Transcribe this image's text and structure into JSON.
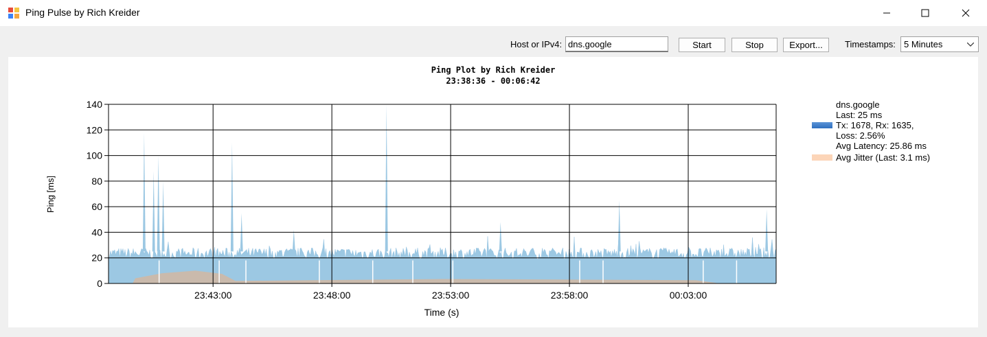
{
  "window": {
    "title": "Ping Pulse by Rich Kreider"
  },
  "toolbar": {
    "host_label": "Host or IPv4:",
    "host_value": "dns.google",
    "start_label": "Start",
    "stop_label": "Stop",
    "export_label": "Export...",
    "timestamps_label": "Timestamps:",
    "timestamps_value": "5 Minutes"
  },
  "colors": {
    "ping_fill": "#9cc8e3",
    "jitter_fill": "#d9b59a",
    "legend_ping": "#2f6fbf",
    "legend_jitter": "#fcd5b8"
  },
  "chart_data": {
    "type": "area",
    "title": "Ping Plot by Rich Kreider",
    "subtitle": "23:38:36 - 00:06:42",
    "xlabel": "Time (s)",
    "ylabel": "Ping [ms]",
    "ylim": [
      0,
      140
    ],
    "yticks": [
      "0",
      "20",
      "40",
      "60",
      "80",
      "100",
      "120",
      "140"
    ],
    "xticks": [
      "23:43:00",
      "23:48:00",
      "23:53:00",
      "23:58:00",
      "00:03:00"
    ],
    "xrange": [
      "23:38:36",
      "00:06:42"
    ],
    "grid": true,
    "legend_position": "right",
    "legend": {
      "host": "dns.google",
      "last": "Last: 25 ms",
      "txrx": "Tx: 1678, Rx: 1635,",
      "loss": "Loss: 2.56%",
      "avg_latency": "Avg Latency: 25.86 ms",
      "jitter": "Avg Jitter (Last: 3.1 ms)"
    },
    "series": [
      {
        "name": "dns.google",
        "baseline_ms": 25,
        "spikes": [
          {
            "time": "23:40:06",
            "ms": 118
          },
          {
            "time": "23:40:30",
            "ms": 88
          },
          {
            "time": "23:40:42",
            "ms": 100
          },
          {
            "time": "23:40:54",
            "ms": 80
          },
          {
            "time": "23:43:48",
            "ms": 110
          },
          {
            "time": "23:50:18",
            "ms": 140
          },
          {
            "time": "23:44:12",
            "ms": 55
          },
          {
            "time": "23:46:24",
            "ms": 42
          },
          {
            "time": "23:55:06",
            "ms": 48
          },
          {
            "time": "00:00:06",
            "ms": 65
          },
          {
            "time": "00:06:18",
            "ms": 58
          }
        ]
      },
      {
        "name": "Avg Jitter (Last: 3.1 ms)",
        "max_ms": 10
      }
    ]
  }
}
